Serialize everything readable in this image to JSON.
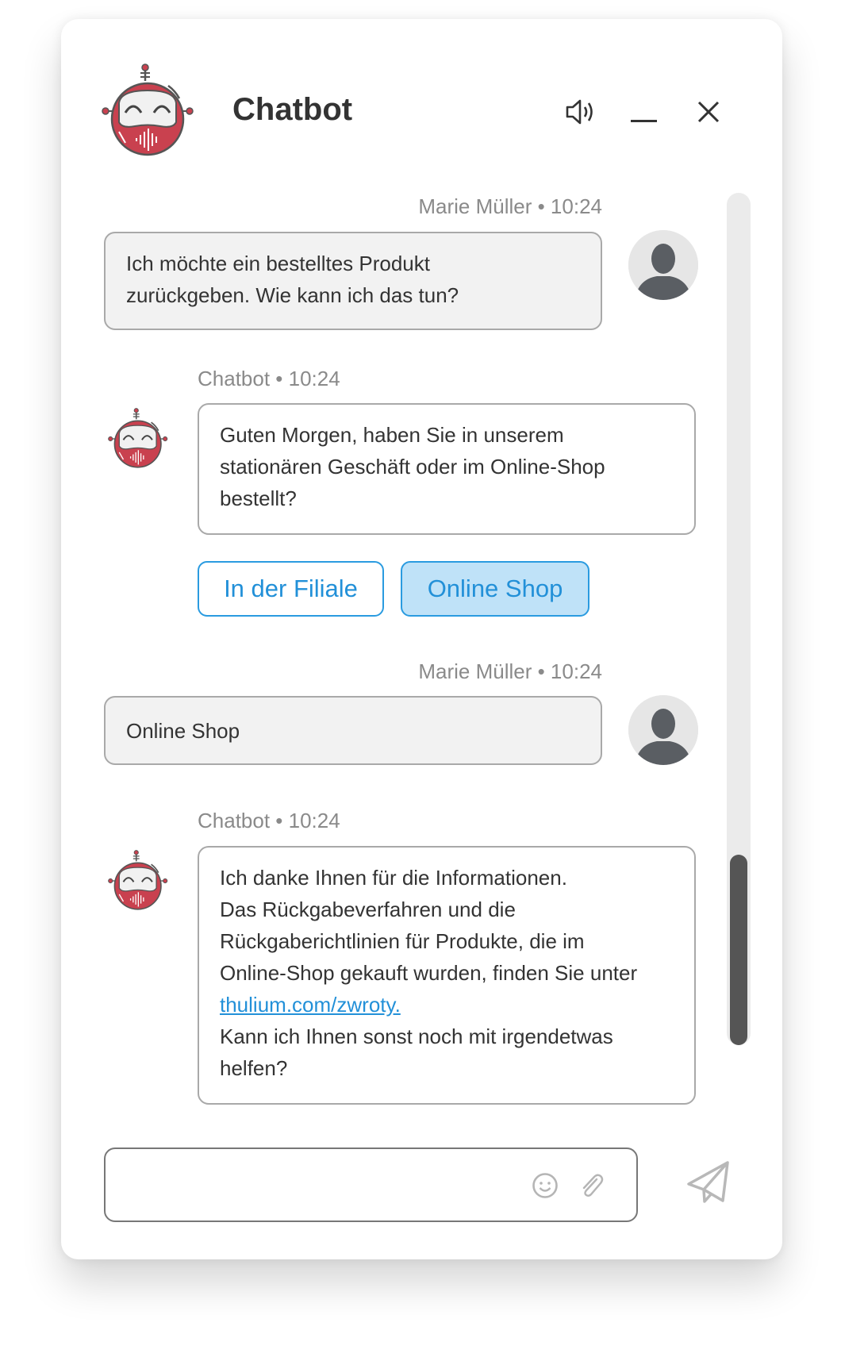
{
  "header": {
    "title": "Chatbot",
    "icons": [
      "speaker-icon",
      "minimize-icon",
      "close-icon"
    ]
  },
  "messages": [
    {
      "sender": "Marie Müller",
      "time": "10:24",
      "meta": "Marie Müller • 10:24",
      "lines": [
        "Ich möchte ein bestelltes Produkt",
        "zurückgeben. Wie kann ich das tun?"
      ]
    },
    {
      "sender": "Chatbot",
      "time": "10:24",
      "meta": "Chatbot • 10:24",
      "lines": [
        "Guten Morgen, haben Sie in unserem",
        "stationären Geschäft oder im Online-Shop",
        "bestellt?"
      ],
      "quick_replies": [
        {
          "label": "In der Filiale",
          "selected": false
        },
        {
          "label": "Online Shop",
          "selected": true
        }
      ]
    },
    {
      "sender": "Marie Müller",
      "time": "10:24",
      "meta": "Marie Müller • 10:24",
      "lines": [
        "Online Shop"
      ]
    },
    {
      "sender": "Chatbot",
      "time": "10:24",
      "meta": "Chatbot • 10:24",
      "lines": [
        "Ich danke Ihnen für die Informationen.",
        "Das Rückgabeverfahren und die",
        "Rückgaberichtlinien für Produkte, die im",
        "Online-Shop gekauft wurden, finden Sie unter"
      ],
      "link": "thulium.com/zwroty.",
      "after": [
        "Kann ich Ihnen sonst noch mit irgendetwas",
        "helfen?"
      ]
    }
  ],
  "composer": {
    "value": "",
    "placeholder": ""
  },
  "colors": {
    "accent": "#2290d8",
    "robot": "#c9414f",
    "selected_reply_bg": "#bfe2f8",
    "user_bubble": "#f2f2f2"
  }
}
